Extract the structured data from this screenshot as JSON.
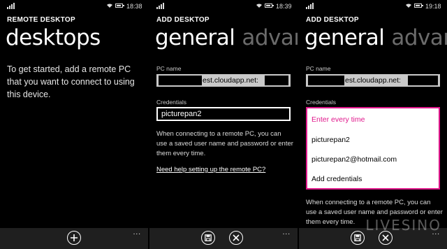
{
  "panels": [
    {
      "time": "18:38",
      "app_title": "REMOTE DESKTOP",
      "pivot_active": "desktops",
      "intro_text": "To get started, add a remote PC that you want to connect to using this device."
    },
    {
      "time": "18:39",
      "app_title": "ADD DESKTOP",
      "pivot_active": "general",
      "pivot_inactive": "advance",
      "pc_name_label": "PC name",
      "pc_name_value": "est.cloudapp.net:",
      "credentials_label": "Credentials",
      "credentials_value": "picturepan2",
      "help_text": "When connecting to a remote PC, you can use a saved user name and password or enter them every time.",
      "help_link": "Need help setting up the remote PC?"
    },
    {
      "time": "19:18",
      "app_title": "ADD DESKTOP",
      "pivot_active": "general",
      "pivot_inactive": "advance",
      "pc_name_label": "PC name",
      "pc_name_value": "est.cloudapp.net:",
      "credentials_label": "Credentials",
      "credential_options": [
        "Enter every time",
        "picturepan2",
        "picturepan2@hotmail.com",
        "Add credentials"
      ],
      "help_text": "When connecting to a remote PC, you can use a saved user name and password or enter them every time."
    }
  ],
  "appbar": {
    "more": "..."
  },
  "watermark": "LIVESINO",
  "colors": {
    "accent": "#e0188c",
    "background": "#000000",
    "appbar": "#1f1f1f"
  },
  "icons": [
    "signal-icon",
    "wifi-icon",
    "battery-icon",
    "add-icon",
    "save-icon",
    "cancel-icon",
    "more-icon"
  ]
}
